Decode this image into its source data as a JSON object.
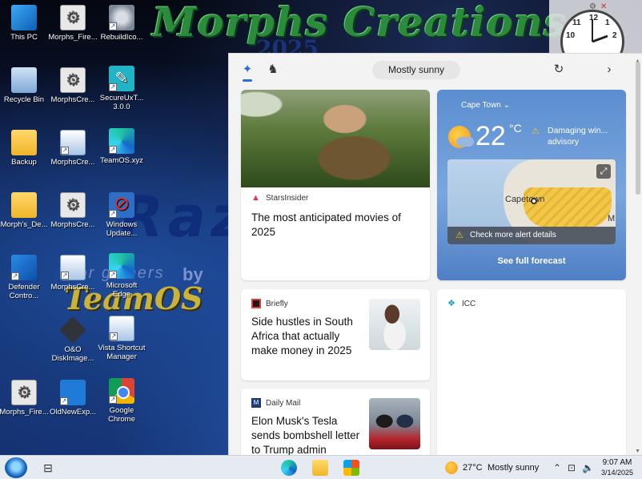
{
  "wallpaper": {
    "title": "Morphs Creations",
    "year": "2025",
    "razer": "Raze",
    "sub": "for gamers",
    "byline": "by",
    "teamos": "TeamOS"
  },
  "desktop_icons": [
    {
      "id": "this-pc",
      "label": "This PC",
      "icon": "computer-icon"
    },
    {
      "id": "morphs-fire-1",
      "label": "Morphs_Fire...",
      "icon": "settings-file-icon"
    },
    {
      "id": "rebuild-icon",
      "label": "RebuildIco...",
      "icon": "robot-icon"
    },
    {
      "id": "recycle-bin",
      "label": "Recycle Bin",
      "icon": "recycle-bin-icon"
    },
    {
      "id": "morphscre-1",
      "label": "MorphsCre...",
      "icon": "settings-file-icon"
    },
    {
      "id": "secureux",
      "label": "SecureUxT...\n3.0.0",
      "icon": "pen-icon"
    },
    {
      "id": "backup",
      "label": "Backup",
      "icon": "folder-icon"
    },
    {
      "id": "morphscre-2",
      "label": "MorphsCre...",
      "icon": "window-shortcut-icon"
    },
    {
      "id": "teamos-xyz",
      "label": "TeamOS.xyz",
      "icon": "edge-icon"
    },
    {
      "id": "morphs-de",
      "label": "Morph's_De...",
      "icon": "folder-icon"
    },
    {
      "id": "morphscre-3",
      "label": "MorphsCre...",
      "icon": "settings-file-icon"
    },
    {
      "id": "windows-update",
      "label": "Windows\nUpdate...",
      "icon": "blocked-update-icon"
    },
    {
      "id": "defender",
      "label": "Defender\nContro...",
      "icon": "windows-icon"
    },
    {
      "id": "morphscre-4",
      "label": "MorphsCre...",
      "icon": "window-shortcut-icon"
    },
    {
      "id": "microsoft-edge",
      "label": "Microsoft\nEdge",
      "icon": "edge-icon"
    },
    {
      "id": "oo-diskimage",
      "label": "O&O\nDiskImage...",
      "icon": "disk-icon"
    },
    {
      "id": "vista-shortcut",
      "label": "Vista Shortcut\nManager",
      "icon": "shortcut-manager-icon"
    },
    {
      "id": "morphs-fire-2",
      "label": "Morphs_Fire...",
      "icon": "settings-file-icon"
    },
    {
      "id": "oldnewexp",
      "label": "OldNewExp...",
      "icon": "shield-icon"
    },
    {
      "id": "google-chrome",
      "label": "Google\nChrome",
      "icon": "chrome-icon"
    }
  ],
  "clock": {
    "numbers": [
      "12",
      "1",
      "2",
      "11",
      "10"
    ]
  },
  "widgets": {
    "top": {
      "weather_pill": "Mostly sunny",
      "widgets_icon": "widgets-icon",
      "games_icon": "chess-knight-icon",
      "refresh_icon": "refresh-icon",
      "next_icon": "chevron-right-icon"
    },
    "movie_card": {
      "source": "StarsInsider",
      "headline": "The most anticipated movies of 2025"
    },
    "weather_card": {
      "location": "Cape Town",
      "temperature": "22",
      "unit": "°C",
      "alert": "Damaging win... advisory",
      "map_label": "Capetown",
      "map_m": "M",
      "alert_bar": "Check more alert details",
      "forecast": "See full forecast"
    },
    "hustle_card": {
      "source": "Briefly",
      "headline": "Side hustles in South Africa that actually make money in 2025"
    },
    "icc_card": {
      "source": "ICC"
    },
    "musk_card": {
      "source": "Daily Mail",
      "headline": "Elon Musk's Tesla sends bombshell letter to Trump admin"
    }
  },
  "taskbar": {
    "weather_temp": "27°C",
    "weather_text": "Mostly sunny",
    "time": "9:07 AM",
    "date": "3/14/2025",
    "pinned": [
      "edge-icon",
      "file-explorer-icon",
      "microsoft-store-icon"
    ]
  }
}
